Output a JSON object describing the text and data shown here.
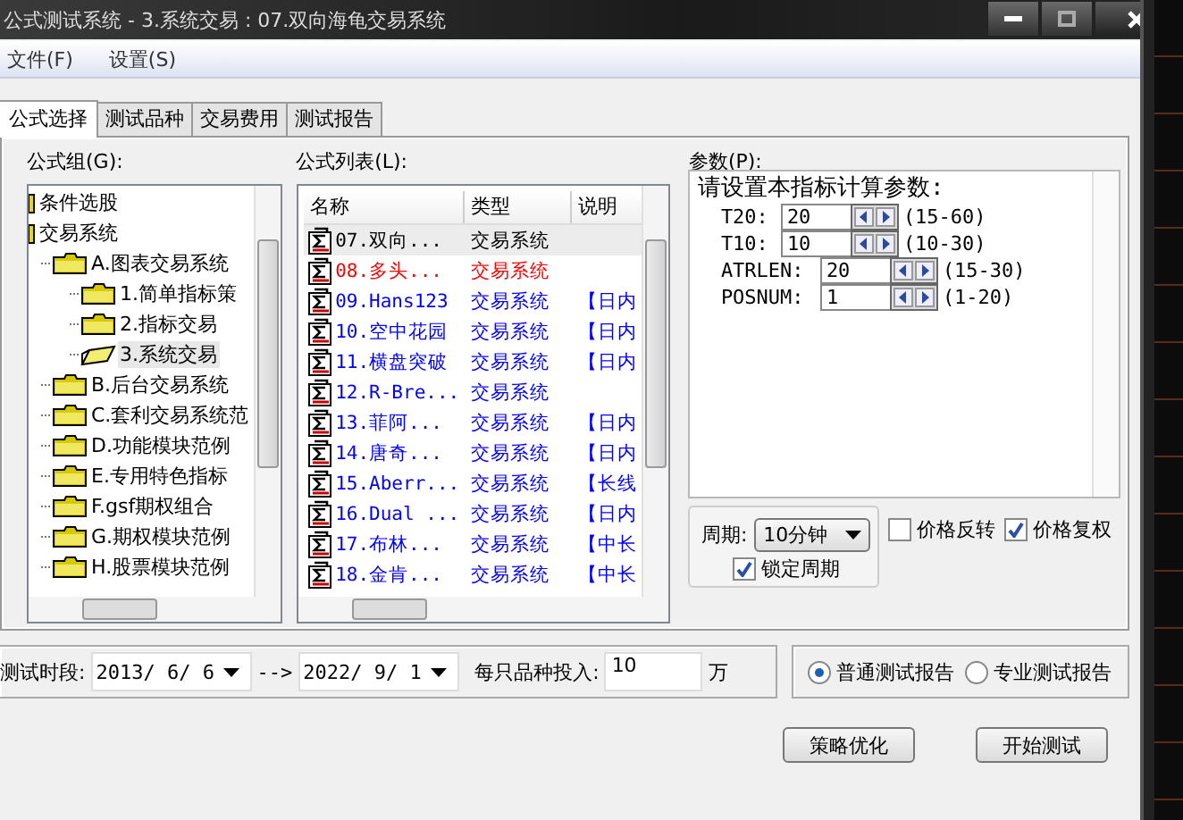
{
  "window": {
    "title": "公式测试系统 - 3.系统交易 : 07.双向海龟交易系统"
  },
  "menu": [
    {
      "label": "文件(F)"
    },
    {
      "label": "设置(S)"
    }
  ],
  "tabs": [
    {
      "label": "公式选择",
      "selected": true
    },
    {
      "label": "测试品种",
      "selected": false
    },
    {
      "label": "交易费用",
      "selected": false
    },
    {
      "label": "测试报告",
      "selected": false
    }
  ],
  "formula_group": {
    "label": "公式组(G):",
    "tree": [
      {
        "label": "条件选股",
        "selected": false
      },
      {
        "label": "交易系统",
        "selected": false,
        "children": [
          {
            "label": "A.图表交易系统",
            "selected": false,
            "children": [
              {
                "label": "1.简单指标策",
                "selected": false
              },
              {
                "label": "2.指标交易",
                "selected": false
              },
              {
                "label": "3.系统交易",
                "selected": true
              }
            ]
          },
          {
            "label": "B.后台交易系统",
            "selected": false
          },
          {
            "label": "C.套利交易系统范",
            "selected": false
          },
          {
            "label": "D.功能模块范例",
            "selected": false
          },
          {
            "label": "E.专用特色指标",
            "selected": false
          },
          {
            "label": "F.gsf期权组合",
            "selected": false
          },
          {
            "label": "G.期权模块范例",
            "selected": false
          },
          {
            "label": "H.股票模块范例",
            "selected": false
          }
        ]
      }
    ]
  },
  "formula_list": {
    "label": "公式列表(L):",
    "columns": [
      "名称",
      "类型",
      "说明"
    ],
    "rows": [
      {
        "name": "07.双向...",
        "type": "交易系统",
        "color": "#000000",
        "selected": true
      },
      {
        "name": "08.多头...",
        "type": "交易系统",
        "color": "#ff0000",
        "selected": false
      },
      {
        "name": "09.Hans123",
        "type": "交易系统",
        "desc": "【日内",
        "color": "#0000ff",
        "selected": false
      },
      {
        "name": "10.空中花园",
        "type": "交易系统",
        "desc": "【日内",
        "color": "#0000ff",
        "selected": false
      },
      {
        "name": "11.横盘突破",
        "type": "交易系统",
        "desc": "【日内",
        "color": "#0000ff",
        "selected": false
      },
      {
        "name": "12.R-Bre...",
        "type": "交易系统",
        "color": "#0000ff",
        "selected": false
      },
      {
        "name": "13.菲阿...",
        "type": "交易系统",
        "desc": "【日内",
        "color": "#0000ff",
        "selected": false
      },
      {
        "name": "14.唐奇...",
        "type": "交易系统",
        "desc": "【日内",
        "color": "#0000ff",
        "selected": false
      },
      {
        "name": "15.Aberr...",
        "type": "交易系统",
        "desc": "【长线",
        "color": "#0000ff",
        "selected": false
      },
      {
        "name": "16.Dual ...",
        "type": "交易系统",
        "desc": "【日内",
        "color": "#0000ff",
        "selected": false
      },
      {
        "name": "17.布林...",
        "type": "交易系统",
        "desc": "【中长",
        "color": "#0000ff",
        "selected": false
      },
      {
        "name": "18.金肯...",
        "type": "交易系统",
        "desc": "【中长",
        "color": "#0000ff",
        "selected": false
      }
    ]
  },
  "parameters": {
    "label": "参数(P):",
    "heading": "请设置本指标计算参数:",
    "items": [
      {
        "name": "T20:",
        "value": "20",
        "range": "(15-60)"
      },
      {
        "name": "T10:",
        "value": "10",
        "range": "(10-30)"
      },
      {
        "name": "ATRLEN:",
        "value": "20",
        "range": "(15-30)"
      },
      {
        "name": "POSNUM:",
        "value": "1",
        "range": "(1-20)"
      }
    ]
  },
  "period": {
    "label": "周期:",
    "value": "10分钟",
    "lock": {
      "label": "锁定周期",
      "checked": true
    }
  },
  "options": [
    {
      "label": "价格反转",
      "checked": false
    },
    {
      "label": "价格复权",
      "checked": true
    }
  ],
  "test_range": {
    "label": "测试时段:",
    "start": "2013/ 6/ 6",
    "arrow": "-->",
    "end": "2022/ 9/ 1"
  },
  "investment": {
    "label": "每只品种投入:",
    "value": "10",
    "unit": "万"
  },
  "report_type": [
    {
      "label": "普通测试报告",
      "selected": true
    },
    {
      "label": "专业测试报告",
      "selected": false
    }
  ],
  "buttons": [
    {
      "label": "策略优化"
    },
    {
      "label": "开始测试"
    }
  ]
}
